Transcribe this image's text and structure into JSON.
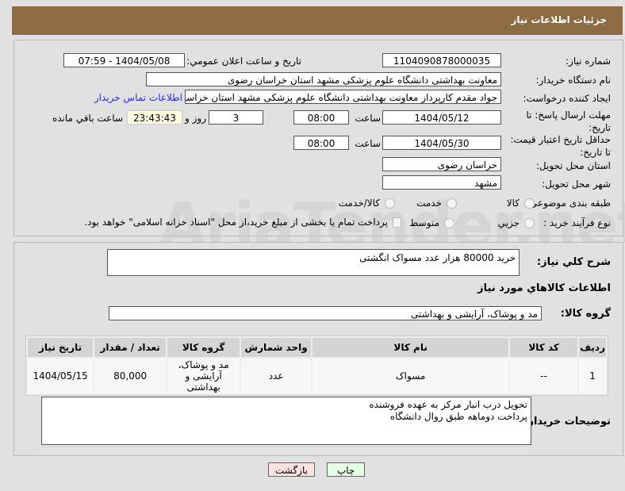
{
  "header": {
    "title": "جزئیات اطلاعات نیاز"
  },
  "form": {
    "need_number_label": "شماره نیاز:",
    "need_number": "1104090878000035",
    "announce_label": "تاریخ و ساعت اعلان عمومي:",
    "announce_value": "1404/05/08 - 07:59",
    "buyer_org_label": "نام دستگاه خریدار:",
    "buyer_org": "معاونت بهداشتی دانشگاه علوم پزشکی مشهد استان خراسان رضوی",
    "creator_label": "ایجاد کننده درخواست:",
    "creator": "جواد مقدم کارپرداز معاونت بهداشتی دانشگاه علوم پزشکی مشهد استان خراسان رضوی",
    "contact_link": "اطلاعات تماس خریدار",
    "deadline_label": "مهلت ارسال پاسخ: تا تاریخ:",
    "deadline_date": "1404/05/12",
    "time_label": "ساعت",
    "deadline_time": "08:00",
    "days": "3",
    "days_label": "روز و",
    "remaining": "23:43:43",
    "remaining_label": "ساعت باقي مانده",
    "validity_label": "حداقل تاریخ اعتبار قیمت: تا تاریخ:",
    "validity_date": "1404/05/30",
    "validity_time": "08:00",
    "province_label": "استان محل تحویل:",
    "province": "خراسان رضوی",
    "city_label": "شهر محل تحویل:",
    "city": "مشهد",
    "category_label": "طبقه بندی موضوعی:",
    "category_options": [
      "کالا",
      "خدمت",
      "کالا/خدمت"
    ],
    "process_label": "نوع فرآیند خرید :",
    "process_options": [
      "جزیي",
      "متوسط"
    ],
    "payment_note": "پرداخت تمام یا بخشی از مبلغ خرید،از محل \"اسناد خزانه اسلامی\" خواهد بود."
  },
  "details": {
    "desc_label": "شرح کلي نیاز:",
    "desc": "خرید 80000 هزار عدد مسواک انگشتی",
    "goods_heading": "اطلاعات کالاهاي مورد نیاز",
    "group_label": "گروه کالا:",
    "group": "مد و پوشاک، آرایشی و بهداشتی",
    "table": {
      "headers": [
        "ردیف",
        "کد کالا",
        "نام کالا",
        "واحد شمارش",
        "گروه کالا",
        "تعداد / مقدار",
        "تاریخ نیاز"
      ],
      "rows": [
        [
          "1",
          "--",
          "مسواک",
          "عدد",
          "مد و پوشاک، آرایشی و بهداشتی",
          "80,000",
          "1404/05/15"
        ]
      ]
    },
    "buyer_notes_label": "توضیحات خریدار:",
    "buyer_notes": "تحویل درب انبار مرکز به عهده فروشنده\nپرداخت دوماهه طبق روال دانشگاه"
  },
  "buttons": {
    "print": "چاپ",
    "back": "بازگشت"
  },
  "watermark": "AriaTender.net"
}
